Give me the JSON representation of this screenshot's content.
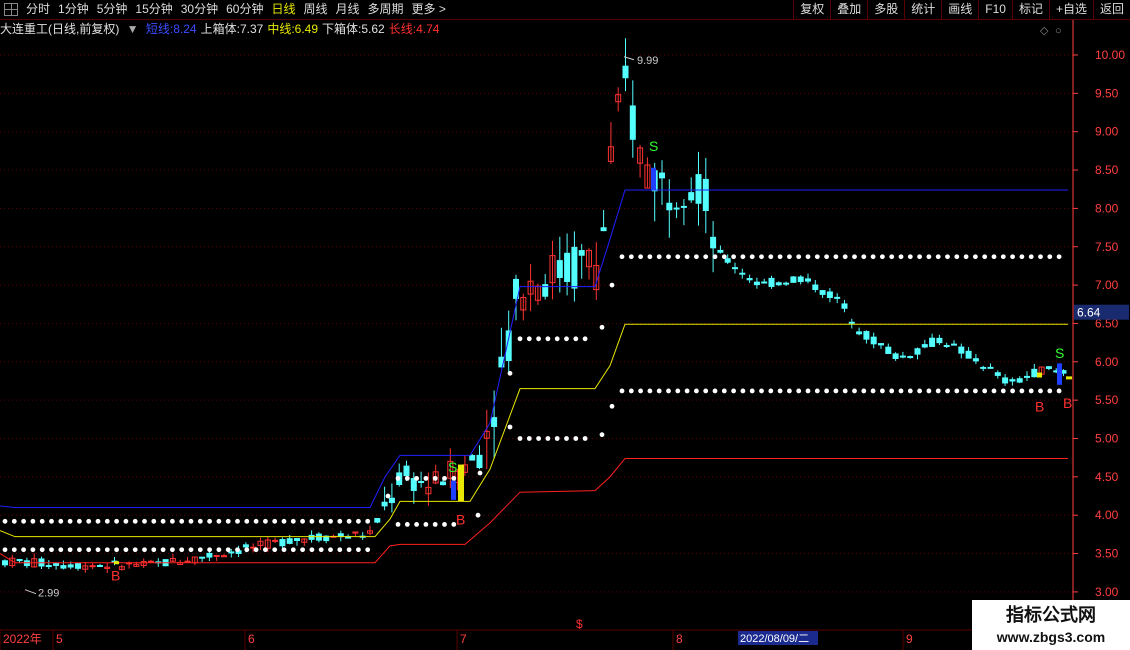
{
  "toolbar": {
    "tabs": [
      {
        "label": "分时",
        "active": false
      },
      {
        "label": "1分钟",
        "active": false
      },
      {
        "label": "5分钟",
        "active": false
      },
      {
        "label": "15分钟",
        "active": false
      },
      {
        "label": "30分钟",
        "active": false
      },
      {
        "label": "60分钟",
        "active": false
      },
      {
        "label": "日线",
        "active": true
      },
      {
        "label": "周线",
        "active": false
      },
      {
        "label": "月线",
        "active": false
      },
      {
        "label": "多周期",
        "active": false
      },
      {
        "label": "更多 >",
        "active": false
      }
    ],
    "right_buttons": [
      "复权",
      "叠加",
      "多股",
      "统计",
      "画线",
      "F10",
      "标记",
      "+自选",
      "返回"
    ]
  },
  "legend": {
    "stock": "大连重工(日线,前复权)",
    "items": [
      {
        "label": "短线:",
        "value": "8.24",
        "color": "#3a4bff"
      },
      {
        "label": "上箱体:",
        "value": "7.37",
        "color": "#e0e0e0"
      },
      {
        "label": "中线:",
        "value": "6.49",
        "color": "#e8e800"
      },
      {
        "label": "下箱体:",
        "value": "5.62",
        "color": "#e0e0e0"
      },
      {
        "label": "长线:",
        "value": "4.74",
        "color": "#ff3030"
      }
    ]
  },
  "price_axis": {
    "ticks": [
      "10.00",
      "9.50",
      "9.00",
      "8.50",
      "8.00",
      "7.50",
      "7.00",
      "6.50",
      "6.00",
      "5.50",
      "5.00",
      "4.50",
      "4.00",
      "3.50",
      "3.00"
    ],
    "current_price": "6.64"
  },
  "date_axis": {
    "labels": [
      "2022年",
      "5",
      "6",
      "7",
      "8",
      "9"
    ],
    "crosshair_date": "2022/08/09/二"
  },
  "annotations": {
    "high": "9.99",
    "low": "2.99",
    "buy": "B",
    "sell": "S"
  },
  "watermark": {
    "line1": "指标公式网",
    "line2": "www.zbgs3.com"
  },
  "colors": {
    "up": "#ff3232",
    "down": "#54ffff",
    "short_line": "#2020ff",
    "mid_line": "#e8e800",
    "long_line": "#ff2020",
    "box": "#ffffff",
    "grid": "#5a0000",
    "axis_text": "#ff4040"
  },
  "chart_data": {
    "type": "candlestick",
    "ylim": [
      2.9,
      10.2
    ],
    "lines": {
      "short_line": 8.24,
      "upper_box": 7.37,
      "mid_line": 6.49,
      "lower_box": 5.62,
      "long_line": 4.74
    }
  }
}
